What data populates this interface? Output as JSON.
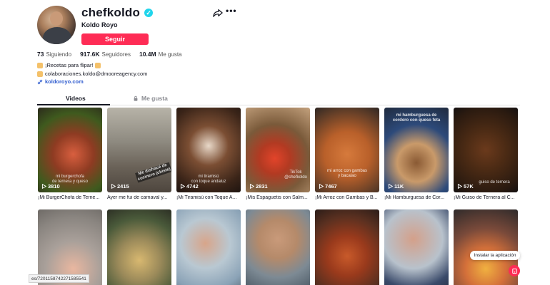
{
  "profile": {
    "username": "chefkoldo",
    "nickname": "Koldo Royo",
    "follow_label": "Seguir"
  },
  "stats": [
    {
      "value": "73",
      "label": "Siguiendo"
    },
    {
      "value": "917.6K",
      "label": "Seguidores"
    },
    {
      "value": "10.4M",
      "label": "Me gusta"
    }
  ],
  "bio": {
    "line1": "¡Recetas para flipar!",
    "line2": "colaboraciones.koldo@dmooreagency.com",
    "link": "koldoroyo.com"
  },
  "tabs": {
    "videos": "Videos",
    "liked": "Me gusta"
  },
  "videos": [
    {
      "views": "3810",
      "caption": "¡Mi BurgerChofa de Terne...",
      "overlay": "mi burgerchofa\nde ternera y queso"
    },
    {
      "views": "2415",
      "caption": "Ayer me fui de carnaval y...",
      "overlay": "Me disfracé de\ncocinero (chiste)"
    },
    {
      "views": "4742",
      "caption": "¡Mi Tiramisú con Toque A...",
      "overlay": "mi tiramisú\ncon toque andaluz"
    },
    {
      "views": "2831",
      "caption": "¡Mis Espaguetis con Salm...",
      "overlay": "TikTok\n@chefkoldo"
    },
    {
      "views": "7467",
      "caption": "¡Mi Arroz con Gambas y B...",
      "overlay": "mi arroz con gambas\ny bacalao"
    },
    {
      "views": "11K",
      "caption": "¡Mi Hamburguesa de Cor...",
      "overlay": "mi hamburguesa de\ncordero con queso feta"
    },
    {
      "views": "57K",
      "caption": "¡Mi Guiso de Ternera al C...",
      "overlay": "guiso de ternera"
    },
    {
      "views": "",
      "caption": "",
      "overlay": ""
    },
    {
      "views": "",
      "caption": "",
      "overlay": ""
    },
    {
      "views": "",
      "caption": "",
      "overlay": ""
    },
    {
      "views": "",
      "caption": "",
      "overlay": ""
    },
    {
      "views": "",
      "caption": "",
      "overlay": ""
    },
    {
      "views": "",
      "caption": "",
      "overlay": ""
    },
    {
      "views": "",
      "caption": "",
      "overlay": ""
    }
  ],
  "install_app": "Instalar la aplicación",
  "status_url": "es/7201158742271585541",
  "colors": {
    "brand": "#fe2c55",
    "verified": "#20d5ec",
    "link": "#2f5ccf"
  },
  "icons": {
    "share": "share-icon",
    "more": "more-icon",
    "lock": "lock-icon",
    "play": "play-icon",
    "link": "link-icon"
  }
}
